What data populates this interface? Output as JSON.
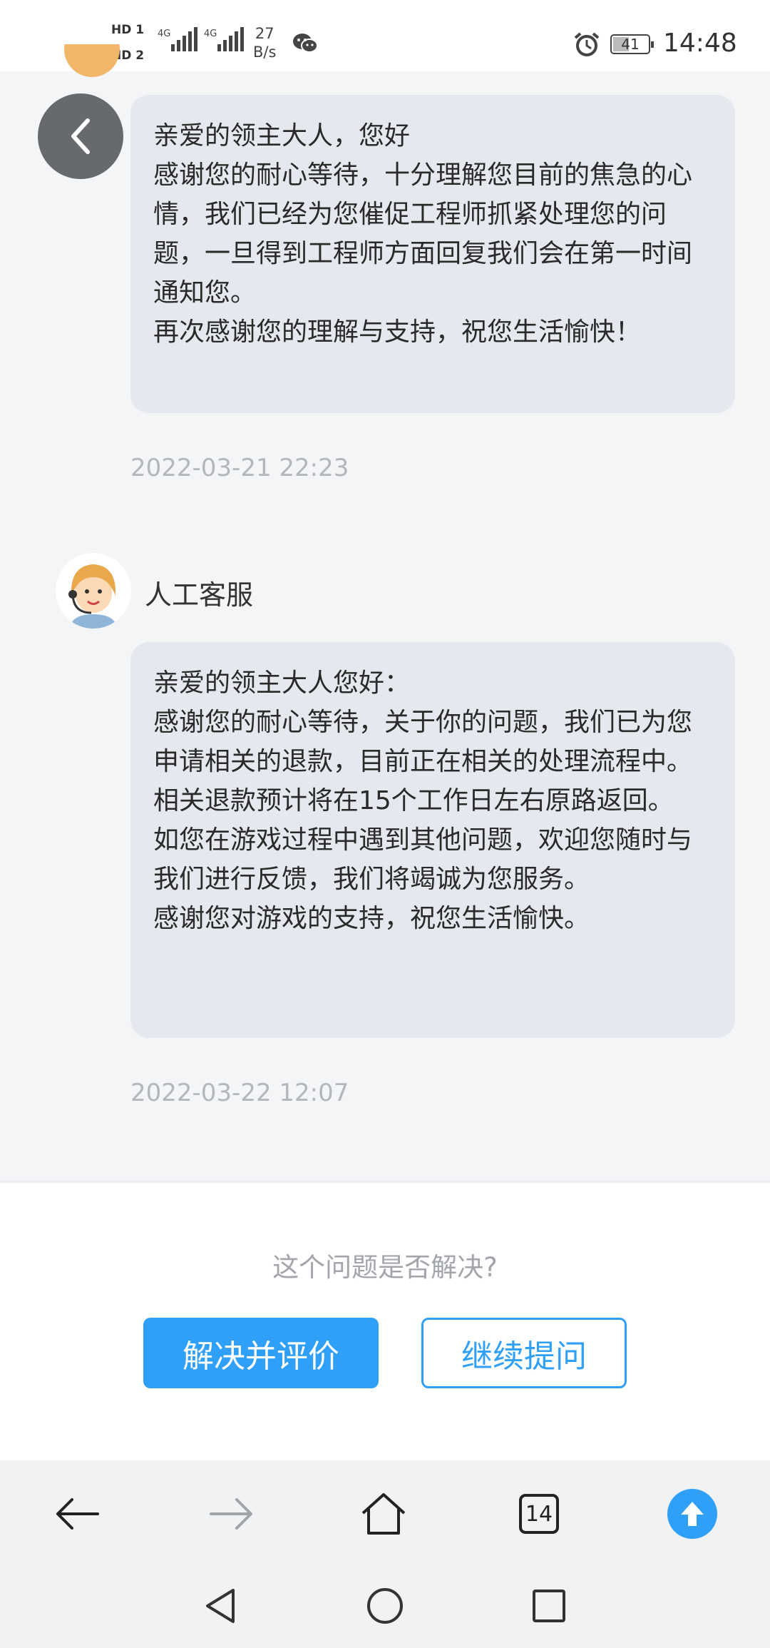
{
  "status_bar": {
    "hd1": "HD 1",
    "hd2": "HD 2",
    "net1": "4G",
    "net2": "4G",
    "speed_value": "27",
    "speed_unit": "B/s",
    "battery": "41",
    "time": "14:48"
  },
  "chat": {
    "messages": [
      {
        "text": "亲爱的领主大人，您好\n感谢您的耐心等待，十分理解您目前的焦急的心情，我们已经为您催促工程师抓紧处理您的问题，一旦得到工程师方面回复我们会在第一时间通知您。\n再次感谢您的理解与支持，祝您生活愉快！",
        "timestamp": "2022-03-21 22:23"
      },
      {
        "sender": "人工客服",
        "text": "亲爱的领主大人您好：\n感谢您的耐心等待，关于你的问题，我们已为您申请相关的退款，目前正在相关的处理流程中。相关退款预计将在15个工作日左右原路返回。\n如您在游戏过程中遇到其他问题，欢迎您随时与我们进行反馈，我们将竭诚为您服务。\n感谢您对游戏的支持，祝您生活愉快。",
        "timestamp": "2022-03-22 12:07"
      }
    ]
  },
  "feedback": {
    "question": "这个问题是否解决?",
    "resolve_label": "解决并评价",
    "continue_label": "继续提问"
  },
  "browser_toolbar": {
    "tab_count": "14"
  },
  "colors": {
    "accent": "#2f9ff7",
    "bubble": "#e5e8ee",
    "background": "#f4f5f7"
  }
}
